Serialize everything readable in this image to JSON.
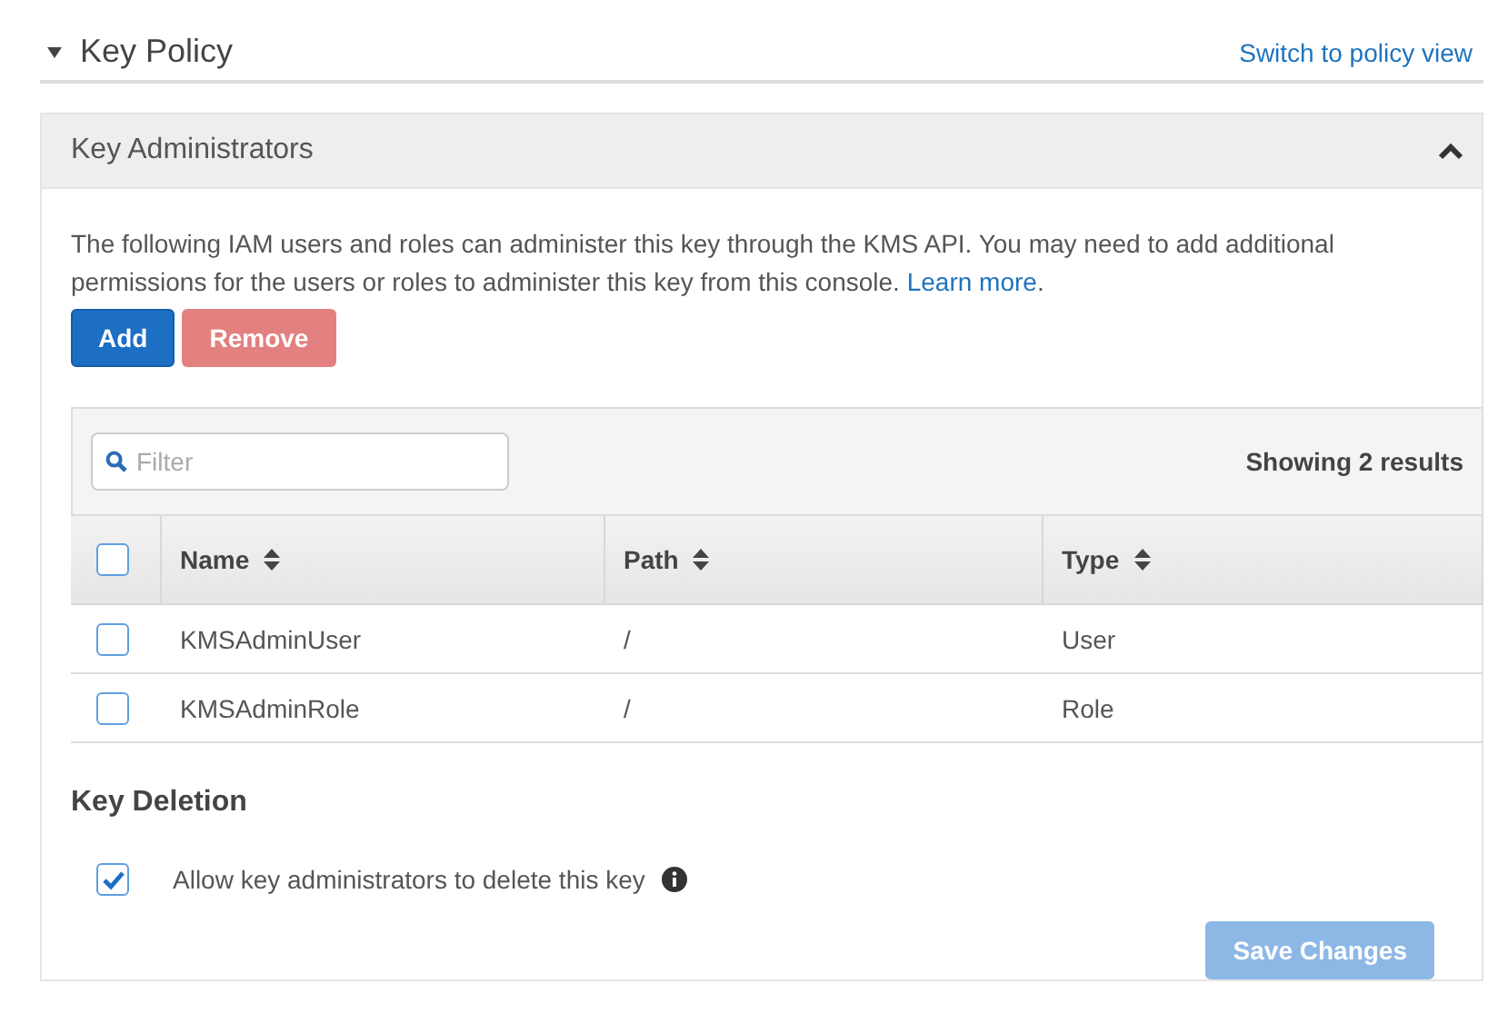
{
  "section": {
    "title": "Key Policy",
    "expanded": true,
    "link": "Switch to policy view"
  },
  "panel": {
    "title": "Key Administrators",
    "expanded": true,
    "description": "The following IAM users and roles can administer this key through the KMS API. You may need to add additional permissions for the users or roles to administer this key from this console.",
    "learn_more": "Learn more",
    "description_end": ".",
    "buttons": [
      {
        "label": "Add",
        "kind": "primary",
        "disabled": false
      },
      {
        "label": "Remove",
        "kind": "danger",
        "disabled": true
      }
    ],
    "filter": {
      "placeholder": "Filter"
    },
    "result_count": "Showing 2 results",
    "table": {
      "select_all": false,
      "columns": [
        "Name",
        "Path",
        "Type"
      ],
      "rows": [
        {
          "checked": false,
          "cells": [
            "KMSAdminUser",
            "/",
            "User"
          ]
        },
        {
          "checked": false,
          "cells": [
            "KMSAdminRole",
            "/",
            "Role"
          ]
        }
      ]
    }
  },
  "deletion": {
    "title": "Key Deletion",
    "option": {
      "label": "Allow key administrators to delete this key",
      "checked": true
    }
  },
  "save_button": {
    "label": "Save Changes",
    "disabled": true
  }
}
